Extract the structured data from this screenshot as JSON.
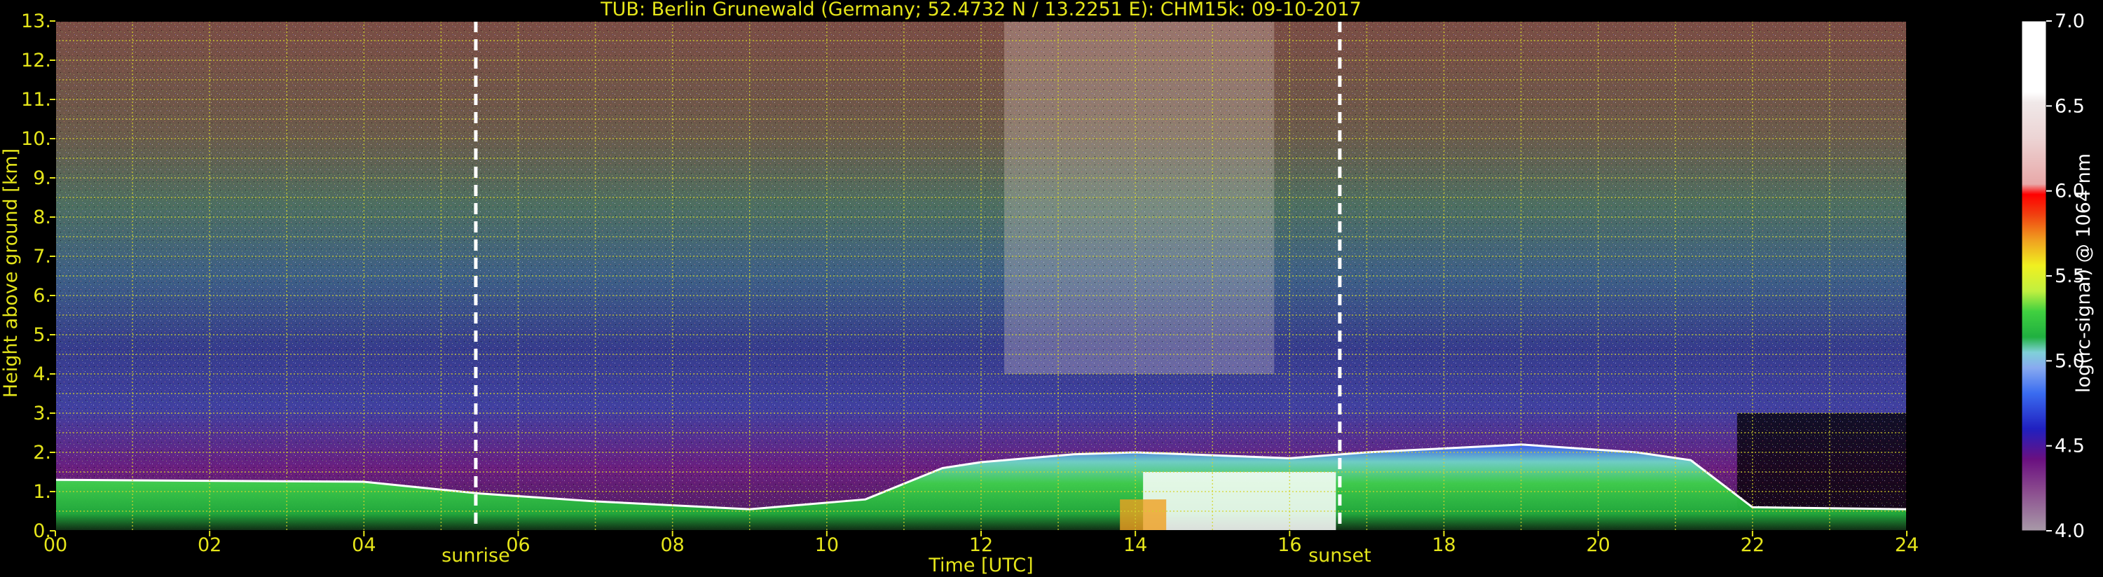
{
  "chart_data": {
    "type": "heatmap",
    "title": "TUB: Berlin Grunewald (Germany; 52.4732 N / 13.2251 E):    CHM15k: 09-10-2017",
    "xlabel": "Time [UTC]",
    "ylabel": "Height above ground [km]",
    "xlim": [
      0,
      24
    ],
    "ylim": [
      0,
      13
    ],
    "x_ticks": [
      "00",
      "02",
      "04",
      "06",
      "08",
      "10",
      "12",
      "14",
      "16",
      "18",
      "20",
      "22",
      "24"
    ],
    "y_ticks": [
      "0.",
      "1.",
      "2.",
      "3.",
      "4.",
      "5.",
      "6.",
      "7.",
      "8.",
      "9.",
      "10.",
      "11.",
      "12.",
      "13."
    ],
    "grid": true,
    "events": [
      {
        "label": "sunrise",
        "time": 5.45
      },
      {
        "label": "sunset",
        "time": 16.65
      }
    ],
    "colorbar": {
      "label": "log(rc-signal) @ 1064 nm",
      "range": [
        4.0,
        7.0
      ],
      "ticks": [
        "4.0",
        "4.5",
        "5.0",
        "5.5",
        "6.0",
        "6.5",
        "7.0"
      ],
      "position": "right"
    },
    "boundary_layer_top_km": [
      {
        "t": 0,
        "h": 1.3
      },
      {
        "t": 4,
        "h": 1.25
      },
      {
        "t": 5.5,
        "h": 0.95
      },
      {
        "t": 7,
        "h": 0.75
      },
      {
        "t": 9,
        "h": 0.55
      },
      {
        "t": 10.5,
        "h": 0.8
      },
      {
        "t": 11.5,
        "h": 1.6
      },
      {
        "t": 12,
        "h": 1.75
      },
      {
        "t": 13.2,
        "h": 1.95
      },
      {
        "t": 14,
        "h": 2.0
      },
      {
        "t": 16,
        "h": 1.85
      },
      {
        "t": 17,
        "h": 2.0
      },
      {
        "t": 19,
        "h": 2.2
      },
      {
        "t": 20.5,
        "h": 2.0
      },
      {
        "t": 21.2,
        "h": 1.8
      },
      {
        "t": 22,
        "h": 0.6
      },
      {
        "t": 24,
        "h": 0.55
      }
    ]
  }
}
